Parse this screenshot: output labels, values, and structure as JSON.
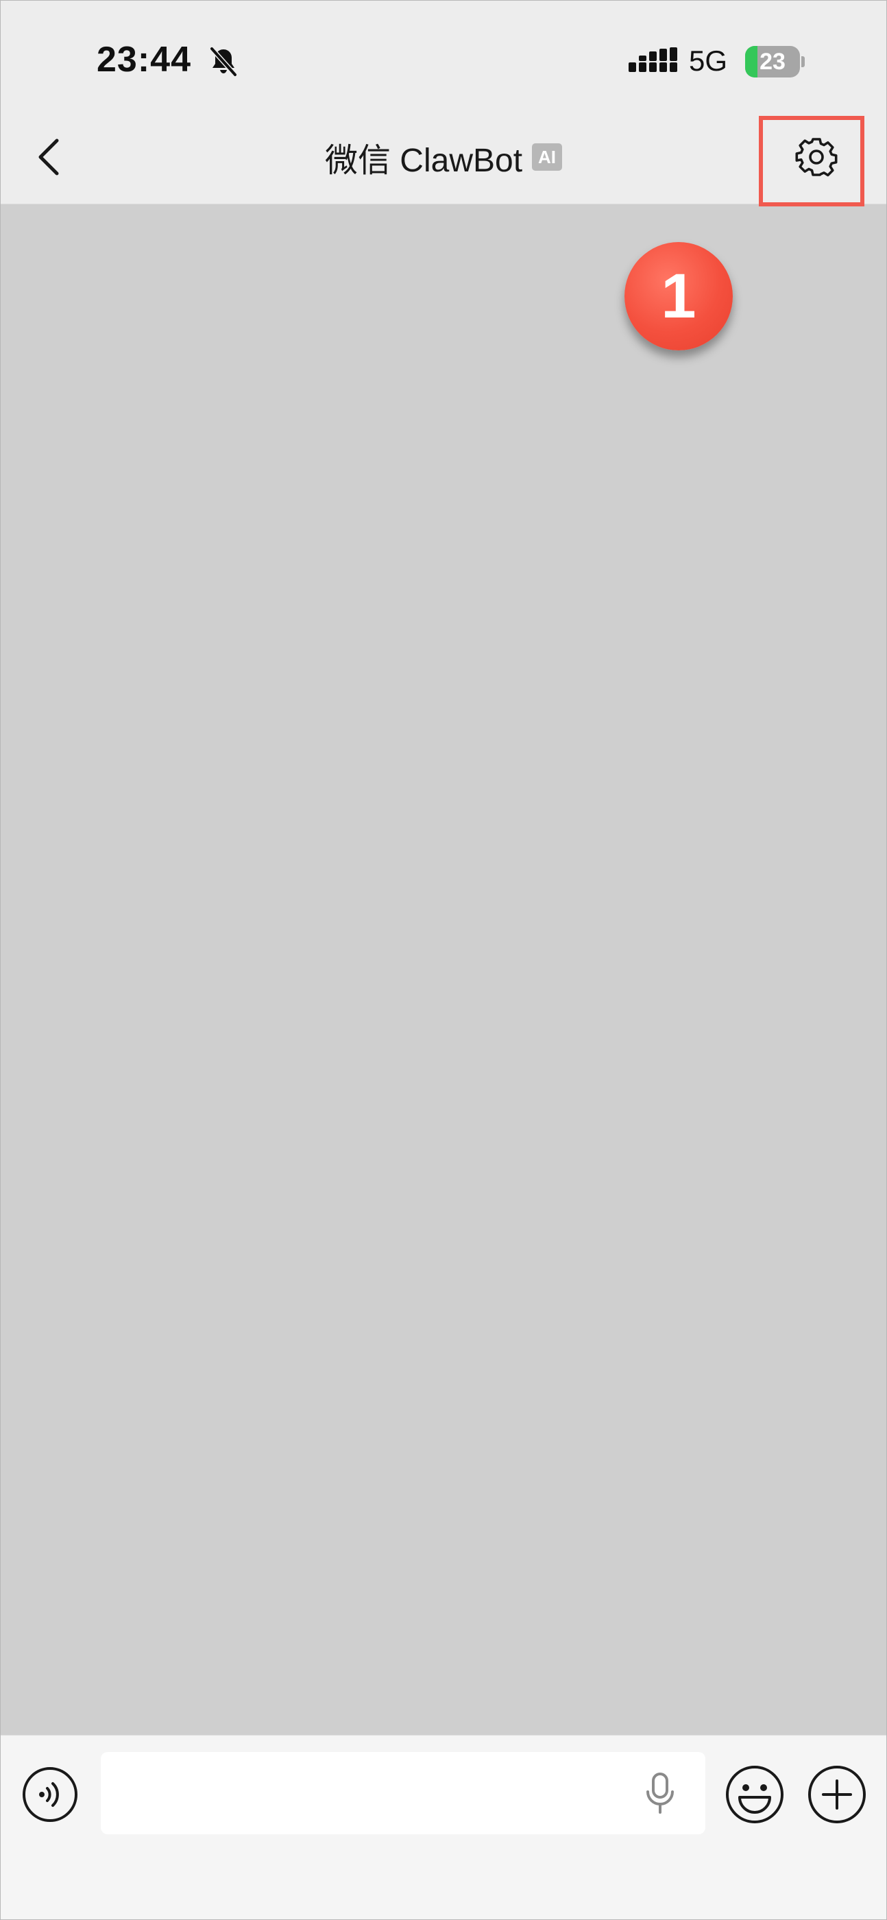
{
  "status_bar": {
    "time": "23:44",
    "network": "5G",
    "battery_level": "23",
    "battery_fraction": 0.23,
    "bell_icon": "bell-slash-icon",
    "signal_icon": "cellular-signal-icon"
  },
  "nav": {
    "back_icon": "chevron-left-icon",
    "title": "微信 ClawBot",
    "badge": "AI",
    "settings_icon": "gear-icon"
  },
  "annotation": {
    "step_number": "1",
    "highlight_color": "#f05a4f"
  },
  "input_bar": {
    "voice_icon": "voice-wave-icon",
    "text_value": "",
    "mic_icon": "microphone-icon",
    "emoji_icon": "smiley-face-icon",
    "more_icon": "plus-circle-icon"
  },
  "colors": {
    "chat_background": "#cfcfcf",
    "bar_background": "#ededed",
    "battery_fill": "#34c759"
  }
}
